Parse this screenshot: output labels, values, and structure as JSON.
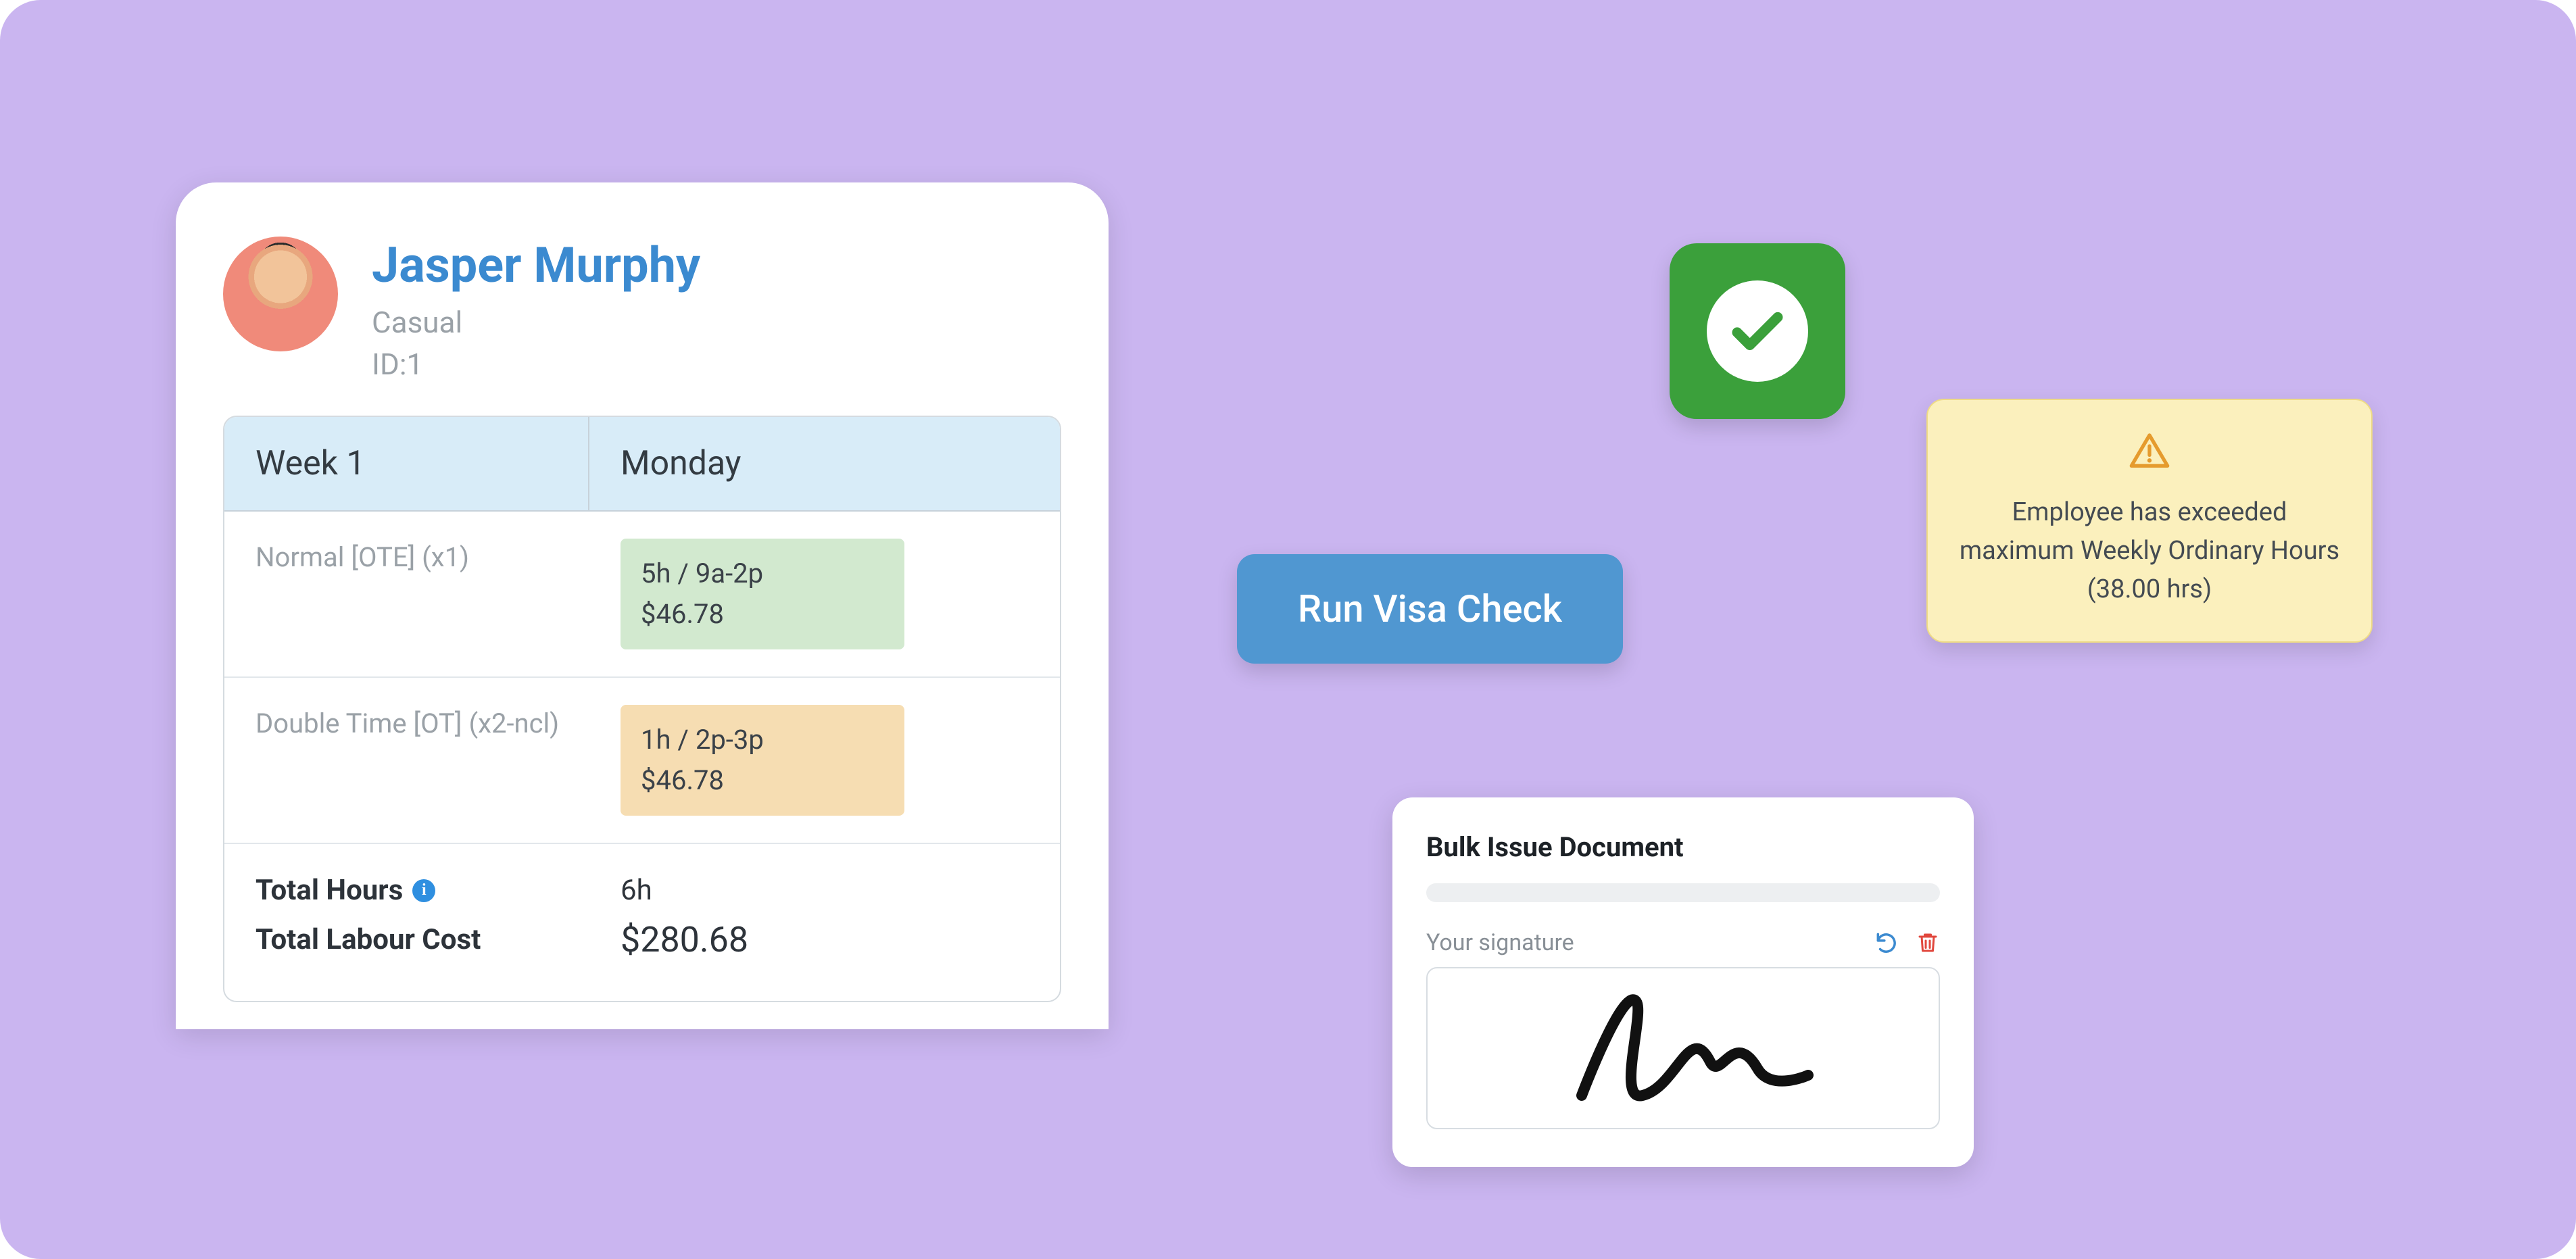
{
  "employee": {
    "name": "Jasper Murphy",
    "type": "Casual",
    "id_label": "ID:1"
  },
  "timesheet": {
    "header": {
      "col1": "Week 1",
      "col2": "Monday"
    },
    "rows": [
      {
        "label": "Normal [OTE] (x1)",
        "chip": {
          "line1": "5h / 9a-2p",
          "line2": "$46.78",
          "tone": "green"
        }
      },
      {
        "label": "Double Time [OT] (x2-ncl)",
        "chip": {
          "line1": "1h / 2p-3p",
          "line2": "$46.78",
          "tone": "amber"
        }
      }
    ],
    "totals": {
      "hours_label": "Total Hours",
      "hours_value": "6h",
      "cost_label": "Total Labour Cost",
      "cost_value": "$280.68"
    }
  },
  "visa_button": "Run Visa Check",
  "warning": {
    "text": "Employee has exceeded maximum Weekly Ordinary Hours (38.00 hrs)"
  },
  "doc": {
    "title": "Bulk Issue Document",
    "signature_label": "Your signature"
  },
  "icons": {
    "info": "info-icon",
    "check": "check-icon",
    "warning": "warning-triangle-icon",
    "undo": "undo-icon",
    "trash": "trash-icon"
  }
}
